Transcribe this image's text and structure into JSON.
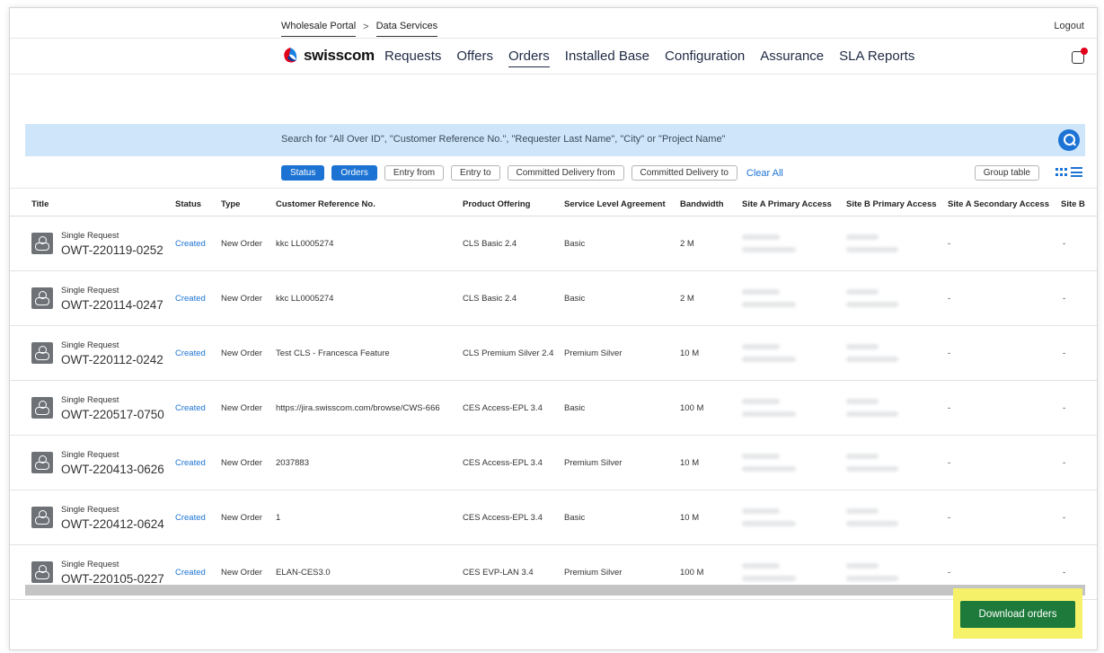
{
  "header": {
    "breadcrumb": [
      "Wholesale Portal",
      "Data Services"
    ],
    "breadcrumb_sep": ">",
    "logout": "Logout",
    "brand": "swisscom",
    "nav": [
      "Requests",
      "Offers",
      "Orders",
      "Installed Base",
      "Configuration",
      "Assurance",
      "SLA Reports"
    ],
    "active_nav": "Orders",
    "icons": {
      "logo": "swisscom-logo-icon",
      "notification": "notification-icon"
    }
  },
  "search": {
    "placeholder": "Search for \"All Over ID\", \"Customer Reference No.\", \"Requester Last Name\", \"City\" or \"Project Name\"",
    "icon": "search-icon"
  },
  "filters": {
    "chips": [
      "Status",
      "Orders",
      "Entry from",
      "Entry to",
      "Committed Delivery from",
      "Committed Delivery to"
    ],
    "active": [
      "Status",
      "Orders"
    ],
    "clear_all": "Clear All",
    "group_table": "Group table",
    "view_icons": [
      "grid-view-icon",
      "list-view-icon"
    ]
  },
  "table": {
    "columns": [
      "Title",
      "Status",
      "Type",
      "Customer Reference No.",
      "Product Offering",
      "Service Level Agreement",
      "Bandwidth",
      "Site A Primary Access",
      "Site B Primary Access",
      "Site A Secondary Access",
      "Site B"
    ],
    "rows": [
      {
        "subtitle": "Single Request",
        "id": "OWT-220119-0252",
        "status": "Created",
        "type": "New Order",
        "ref": "kkc LL0005274",
        "product": "CLS Basic 2.4",
        "sla": "Basic",
        "bandwidth": "2 M",
        "site_a_secondary": "-",
        "site_b_secondary": "-"
      },
      {
        "subtitle": "Single Request",
        "id": "OWT-220114-0247",
        "status": "Created",
        "type": "New Order",
        "ref": "kkc LL0005274",
        "product": "CLS Basic 2.4",
        "sla": "Basic",
        "bandwidth": "2 M",
        "site_a_secondary": "-",
        "site_b_secondary": "-"
      },
      {
        "subtitle": "Single Request",
        "id": "OWT-220112-0242",
        "status": "Created",
        "type": "New Order",
        "ref": "Test CLS - Francesca Feature",
        "product": "CLS Premium Silver 2.4",
        "sla": "Premium Silver",
        "bandwidth": "10 M",
        "site_a_secondary": "-",
        "site_b_secondary": "-"
      },
      {
        "subtitle": "Single Request",
        "id": "OWT-220517-0750",
        "status": "Created",
        "type": "New Order",
        "ref": "https://jira.swisscom.com/browse/CWS-666",
        "product": "CES Access-EPL 3.4",
        "sla": "Basic",
        "bandwidth": "100 M",
        "site_a_secondary": "-",
        "site_b_secondary": "-"
      },
      {
        "subtitle": "Single Request",
        "id": "OWT-220413-0626",
        "status": "Created",
        "type": "New Order",
        "ref": "2037883",
        "product": "CES Access-EPL 3.4",
        "sla": "Premium Silver",
        "bandwidth": "10 M",
        "site_a_secondary": "-",
        "site_b_secondary": "-"
      },
      {
        "subtitle": "Single Request",
        "id": "OWT-220412-0624",
        "status": "Created",
        "type": "New Order",
        "ref": "1",
        "product": "CES Access-EPL 3.4",
        "sla": "Basic",
        "bandwidth": "10 M",
        "site_a_secondary": "-",
        "site_b_secondary": "-"
      },
      {
        "subtitle": "Single Request",
        "id": "OWT-220105-0227",
        "status": "Created",
        "type": "New Order",
        "ref": "ELAN-CES3.0",
        "product": "CES EVP-LAN 3.4",
        "sla": "Premium Silver",
        "bandwidth": "100 M",
        "site_a_secondary": "-",
        "site_b_secondary": "-"
      }
    ],
    "row_icon": "request-type-icon"
  },
  "footer": {
    "download": "Download orders"
  },
  "colors": {
    "accent": "#1c73d4",
    "search_bg": "#cfe6fa",
    "download_bg": "#1d7a3a",
    "highlight": "#f5f26a",
    "brand_red": "#e3001b"
  }
}
